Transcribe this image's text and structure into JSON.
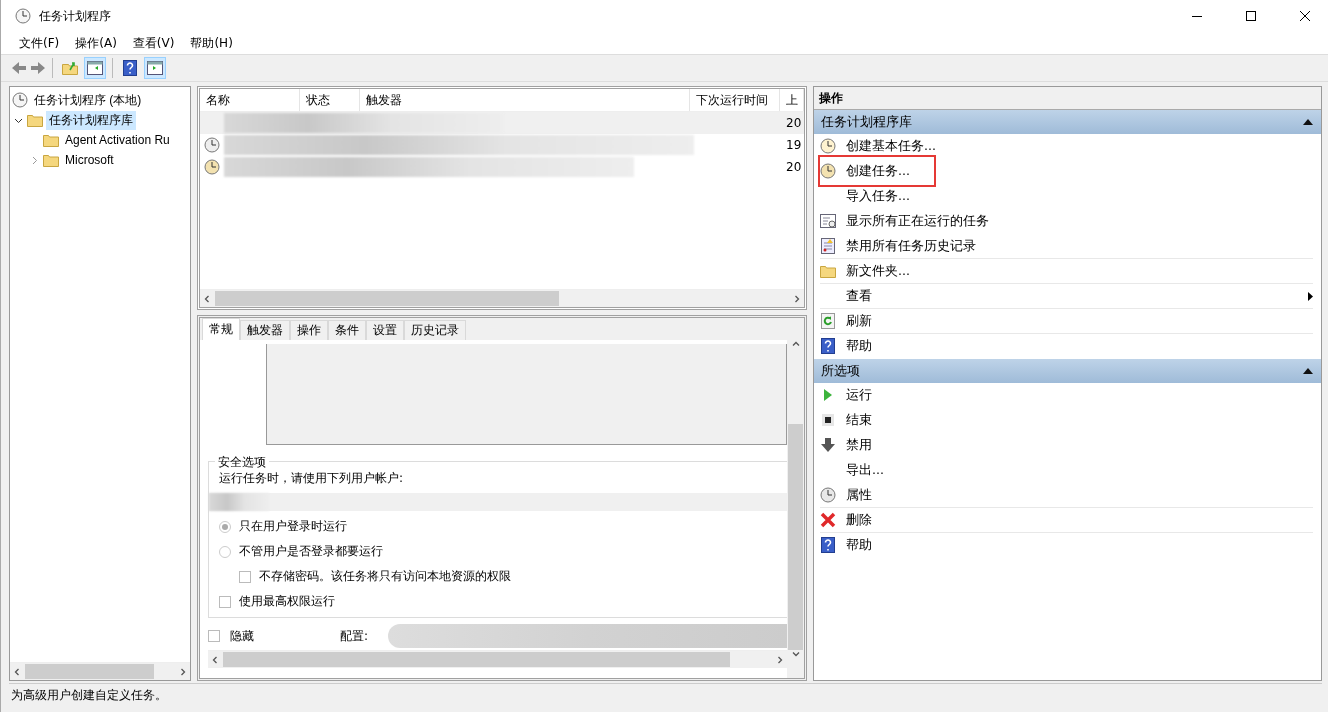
{
  "window": {
    "title": "任务计划程序"
  },
  "menu": [
    "文件(F)",
    "操作(A)",
    "查看(V)",
    "帮助(H)"
  ],
  "tree": {
    "label": "任务计划程序 (本地)",
    "children": [
      {
        "label": "任务计划程序库",
        "selected": true,
        "expanded": true,
        "children": [
          {
            "label": "Agent Activation Ru",
            "selected": false,
            "expandable": false
          },
          {
            "label": "Microsoft",
            "selected": false,
            "expandable": true
          }
        ]
      }
    ]
  },
  "task_list": {
    "columns": [
      "名称",
      "状态",
      "触发器",
      "下次运行时间",
      "上"
    ],
    "rows": [
      {
        "column_5": "20",
        "selected": true
      },
      {
        "column_5": "19",
        "selected": false
      },
      {
        "column_5": "20",
        "selected": false
      }
    ]
  },
  "detail_tabs": [
    {
      "label": "常规",
      "selected": true
    },
    {
      "label": "触发器",
      "selected": false
    },
    {
      "label": "操作",
      "selected": false
    },
    {
      "label": "条件",
      "selected": false
    },
    {
      "label": "设置",
      "selected": false
    },
    {
      "label": "历史记录",
      "selected": false
    }
  ],
  "security": {
    "title": "安全选项",
    "prompt": "运行任务时，请使用下列用户帐户:",
    "options": [
      {
        "kind": "radio",
        "label": "只在用户登录时运行",
        "selected": true,
        "indented": false
      },
      {
        "kind": "radio",
        "label": "不管用户是否登录都要运行",
        "selected": false,
        "indented": false
      },
      {
        "kind": "checkbox",
        "label": "不存储密码。该任务将只有访问本地资源的权限",
        "checked": false,
        "indented": true
      },
      {
        "kind": "checkbox",
        "label": "使用最高权限运行",
        "checked": false,
        "indented": false
      }
    ]
  },
  "hidden_checkbox": {
    "label": "隐藏",
    "checked": false
  },
  "config_label": "配置:",
  "actions": {
    "title": "操作",
    "sections": [
      {
        "title": "任务计划程序库",
        "expanded": true,
        "items": [
          {
            "label": "创建基本任务...",
            "highlighted": false,
            "divider_after": false,
            "submenu": false
          },
          {
            "label": "创建任务...",
            "highlighted": true,
            "divider_after": false,
            "submenu": false
          },
          {
            "label": "导入任务...",
            "highlighted": false,
            "divider_after": false,
            "submenu": false
          },
          {
            "label": "显示所有正在运行的任务",
            "highlighted": false,
            "divider_after": false,
            "submenu": false
          },
          {
            "label": "禁用所有任务历史记录",
            "highlighted": false,
            "divider_after": true,
            "submenu": false
          },
          {
            "label": "新文件夹...",
            "highlighted": false,
            "divider_after": true,
            "submenu": false
          },
          {
            "label": "查看",
            "highlighted": false,
            "divider_after": true,
            "submenu": true
          },
          {
            "label": "刷新",
            "highlighted": false,
            "divider_after": true,
            "submenu": false
          },
          {
            "label": "帮助",
            "highlighted": false,
            "divider_after": false,
            "submenu": false
          }
        ]
      },
      {
        "title": "所选项",
        "expanded": true,
        "items": [
          {
            "label": "运行",
            "highlighted": false,
            "divider_after": false,
            "submenu": false
          },
          {
            "label": "结束",
            "highlighted": false,
            "divider_after": false,
            "submenu": false
          },
          {
            "label": "禁用",
            "highlighted": false,
            "divider_after": false,
            "submenu": false
          },
          {
            "label": "导出...",
            "highlighted": false,
            "divider_after": false,
            "submenu": false
          },
          {
            "label": "属性",
            "highlighted": false,
            "divider_after": true,
            "submenu": false
          },
          {
            "label": "删除",
            "highlighted": false,
            "divider_after": true,
            "submenu": false
          },
          {
            "label": "帮助",
            "highlighted": false,
            "divider_after": false,
            "submenu": false
          }
        ]
      }
    ]
  },
  "status_bar": "为高级用户创建自定义任务。"
}
